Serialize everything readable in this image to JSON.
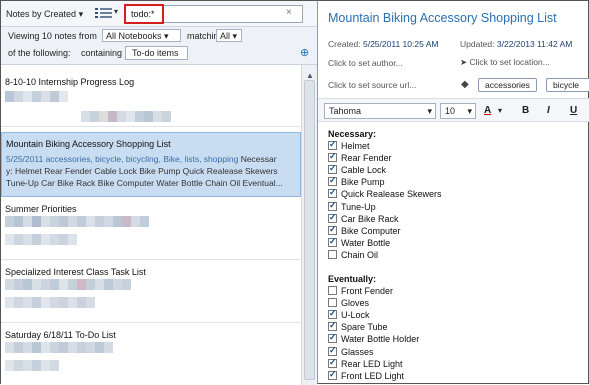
{
  "search": {
    "query": "todo:*",
    "clear_icon": "×"
  },
  "sort": {
    "label": "Notes by Created",
    "arrow": "▾"
  },
  "filter": {
    "viewing_prefix": "Viewing 10 notes from",
    "notebook": "All Notebooks",
    "matching_label": "matching",
    "matching_value": "All",
    "of_following": "of the following:",
    "containing_label": "containing",
    "containing_value": "To-do items",
    "arrow": "▾"
  },
  "notes": [
    {
      "title": "8-10-10 Internship Progress Log",
      "selected": false
    },
    {
      "title": "Mountain Biking Accessory Shopping List",
      "selected": true,
      "date": "5/25/2011",
      "tags": "accessories, bicycle, bicycling, Bike, lists, shopping",
      "snippet_tail": "Necessar",
      "snippet_line2": "y: Helmet Rear Fender Cable Lock Bike Pump Quick Realease Skewers",
      "snippet_line3": "Tune-Up Car Bike Rack Bike Computer Water Bottle Chain Oil Eventual..."
    },
    {
      "title": "Summer Priorities",
      "selected": false
    },
    {
      "title": "Specialized Interest Class Task List",
      "selected": false
    },
    {
      "title": "Saturday 6/18/11 To-Do List",
      "selected": false
    }
  ],
  "editor": {
    "title": "Mountain Biking Accessory Shopping List",
    "created_label": "Created:",
    "created_value": "5/25/2011 10:25 AM",
    "updated_label": "Updated:",
    "updated_value": "3/22/2013 11:42 AM",
    "author_placeholder": "Click to set author...",
    "location_placeholder": "Click to set location...",
    "source_placeholder": "Click to set source url...",
    "tags": [
      "accessories",
      "bicycle"
    ],
    "font": "Tahoma",
    "size": "10",
    "bold": "B",
    "italic": "I",
    "underline": "U",
    "font_color": "A"
  },
  "sections": [
    {
      "heading": "Necessary:",
      "items": [
        {
          "label": "Helmet",
          "checked": true
        },
        {
          "label": "Rear Fender",
          "checked": true
        },
        {
          "label": "Cable Lock",
          "checked": true
        },
        {
          "label": "Bike Pump",
          "checked": true
        },
        {
          "label": "Quick Realease Skewers",
          "checked": true
        },
        {
          "label": "Tune-Up",
          "checked": true
        },
        {
          "label": "Car Bike Rack",
          "checked": true
        },
        {
          "label": "Bike Computer",
          "checked": true
        },
        {
          "label": "Water Bottle",
          "checked": true
        },
        {
          "label": "Chain Oil",
          "checked": false
        }
      ]
    },
    {
      "heading": "Eventually:",
      "items": [
        {
          "label": "Front Fender",
          "checked": false
        },
        {
          "label": "Gloves",
          "checked": false
        },
        {
          "label": "U-Lock",
          "checked": true
        },
        {
          "label": "Spare Tube",
          "checked": true
        },
        {
          "label": "Water Bottle Holder",
          "checked": true
        },
        {
          "label": "Glasses",
          "checked": true
        },
        {
          "label": "Rear LED Light",
          "checked": true
        },
        {
          "label": "Front LED Light",
          "checked": true
        }
      ]
    }
  ],
  "colors": {
    "accent": "#2a6fb0",
    "selection": "#c9ddf2",
    "highlight": "#d41e1e"
  }
}
